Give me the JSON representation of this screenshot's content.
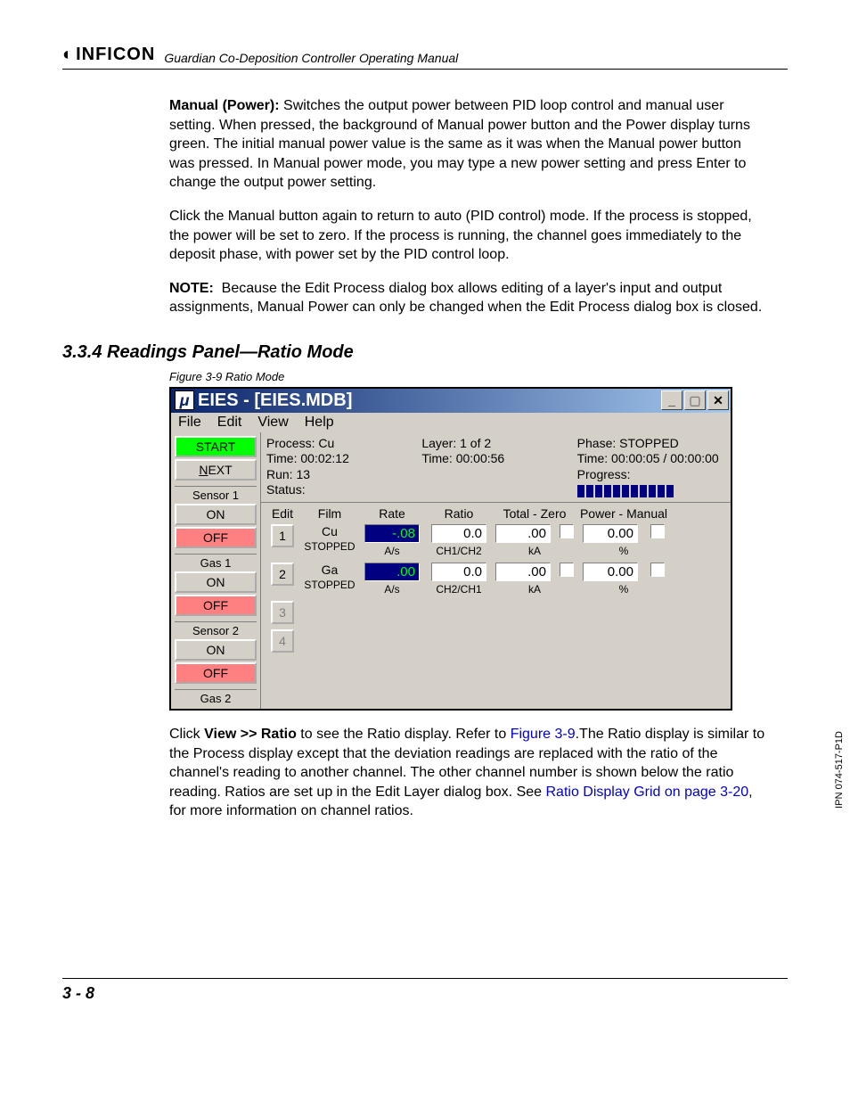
{
  "header": {
    "brand": "INFICON",
    "manual_title": "Guardian Co-Deposition Controller Operating Manual"
  },
  "para1_label": "Manual (Power): ",
  "para1": "Switches the output power between PID loop control and manual user setting. When pressed, the background of Manual power button and the Power display turns green. The initial manual power value is the same as it was when the Manual power button was pressed. In Manual power mode, you may type a new power setting and press Enter to change the output power setting.",
  "para2": "Click the Manual button again to return to auto (PID control) mode. If the process is stopped, the power will be set to zero. If the process is running, the channel goes immediately to the deposit phase, with power set by the PID control loop.",
  "note_label": "NOTE:",
  "note_text": "Because the Edit Process dialog box allows editing of a layer's input and output assignments, Manual Power can only be changed when the Edit Process dialog box is closed.",
  "section_heading": "3.3.4  Readings Panel—Ratio Mode",
  "figure_caption": "Figure 3-9  Ratio Mode",
  "app": {
    "title": "EIES - [EIES.MDB]",
    "menus": [
      "File",
      "Edit",
      "View",
      "Help"
    ],
    "left_buttons": {
      "start": "START",
      "next": "NEXT",
      "sensor1": "Sensor 1",
      "on": "ON",
      "off": "OFF",
      "gas1": "Gas 1",
      "sensor2": "Sensor 2",
      "gas2": "Gas 2"
    },
    "status": {
      "process": "Process: Cu",
      "time": "Time: 00:02:12",
      "run": "Run: 13",
      "status": "Status:",
      "layer": "Layer: 1 of 2",
      "layer_time": "Time: 00:00:56",
      "phase": "Phase: STOPPED",
      "phase_time": "Time: 00:00:05 / 00:00:00",
      "progress_label": "Progress:"
    },
    "grid": {
      "headers": {
        "edit": "Edit",
        "film": "Film",
        "rate": "Rate",
        "ratio": "Ratio",
        "total": "Total  -  Zero",
        "power": "Power - Manual"
      },
      "rows": [
        {
          "num": "1",
          "film": "Cu",
          "film_state": "STOPPED",
          "rate": "-.08",
          "rate_unit": "A/s",
          "ratio": "0.0",
          "ratio_sub": "CH1/CH2",
          "total": ".00",
          "total_unit": "kA",
          "power": "0.00",
          "power_unit": "%"
        },
        {
          "num": "2",
          "film": "Ga",
          "film_state": "STOPPED",
          "rate": ".00",
          "rate_unit": "A/s",
          "ratio": "0.0",
          "ratio_sub": "CH2/CH1",
          "total": ".00",
          "total_unit": "kA",
          "power": "0.00",
          "power_unit": "%"
        }
      ],
      "disabled_nums": [
        "3",
        "4"
      ]
    }
  },
  "after1a": "Click ",
  "after1b": "View >> Ratio",
  "after1c": " to see the Ratio display. Refer to ",
  "after1_link1": "Figure 3-9",
  "after1d": ".The Ratio display is similar to the Process display except that the deviation readings are replaced with the ratio of the channel's reading to another channel. The other channel number is shown below the ratio reading. Ratios are set up in the Edit Layer dialog box. See ",
  "after1_link2": "Ratio Display Grid on page 3-20",
  "after1e": ", for more information on channel ratios.",
  "page_number": "3 - 8",
  "side_code": "IPN 074-517-P1D"
}
